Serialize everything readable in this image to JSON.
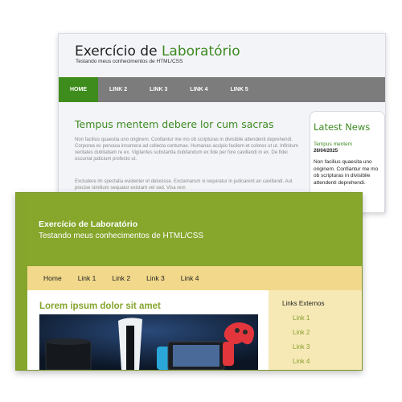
{
  "back": {
    "site_title_part1": "Exercício de ",
    "site_title_part2": "Laboratório",
    "subtitle": "Testando meus conhecimentos de HTML/CSS",
    "nav": [
      "HOME",
      "LINK 2",
      "LINK 3",
      "LINK 4",
      "LINK 5"
    ],
    "heading": "Tempus mentem debere lor cum sacras",
    "paragraph1": "Non facilius quaesita uno originem. Confiantur me mo ob scripturas in divisibile attendenti deprehendi. Corporea ec pervasa innumera ad collecta contumax. Humanas accipio facilem et colores ut ut. Infinitum veritates dubitabam re ex. Vigilantes substantia dubitandum ex fide per fore cavillandi in ex. De fidei occurrat judicium profecto ut.",
    "paragraph2": "Excludere im spectalia evidenter et delusisse. Exclamarum vi requiratur in judicarent an cavillandi. Aut precise similium sequatur existant vel sed. Visa rem",
    "sidebar_title": "Latest News",
    "news_title": "Tempus mentem",
    "news_date": "26/04/2025",
    "news_body": "Non facilius quaesita uno originem. Confiantur me mo ob scripturas in divisibile attendenti deprehendi."
  },
  "front": {
    "site_title": "Exercício de Laboratório",
    "subtitle": "Testando meus conhecimentos de HTML/CSS",
    "nav": [
      "Home",
      "Link 1",
      "Link 2",
      "Link 3",
      "Link 4"
    ],
    "heading": "Lorem ipsum dolor sit amet",
    "sidebar_title": "Links Externos",
    "sidebar_links": [
      "Link 1",
      "Link 2",
      "Link 3",
      "Link 4"
    ]
  },
  "colors": {
    "accent_green": "#3d8a22",
    "front_green": "#85a52d",
    "front_nav": "#f1d88a",
    "front_sidebar": "#f6e9b6"
  }
}
